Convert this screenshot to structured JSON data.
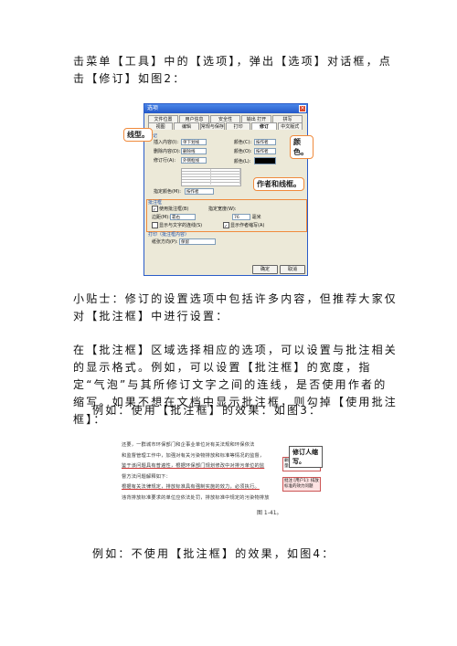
{
  "paragraphs": {
    "p1": "击菜单【工具】中的【选项】，弹出【选项】对话框，点击【修订】如图2：",
    "p2": "小贴士：修订的设置选项中包括许多内容，但推荐大家仅对【批注框】中进行设置：",
    "p3": "在【批注框】区域选择相应的选项，可以设置与批注相关的显示格式。例如，可以设置【批注框】的宽度，指定“气泡”与其所修订文字之间的连线，是否使用作者的缩写。如果不想在文档中显示批注框，则勾掉【使用批注框】：",
    "p4": "例如：使用【批注框】的效果：如图3：",
    "p5": "例如：不使用【批注框】的效果，如图4："
  },
  "fig2": {
    "title": "选项",
    "tabs_row1": [
      "文件位置",
      "用户信息",
      "安全性",
      "输出 打开",
      "拼写"
    ],
    "tabs_row2": [
      "视图",
      "编辑",
      "常规与保存",
      "打印",
      "修订",
      "中文版式"
    ],
    "section_mark": "标记",
    "rows": [
      {
        "label": "插入内容(I):",
        "value": "单下划线",
        "color_label": "颜色(C):",
        "color_value": "按作者"
      },
      {
        "label": "删除内容(D):",
        "value": "删除线",
        "color_label": "颜色(O):",
        "color_value": "按作者"
      },
      {
        "label": "修订行(A):",
        "value": "外侧框线",
        "color_label": "颜色(L):",
        "color_value": ""
      }
    ],
    "format_label": "指定颜色(M):",
    "format_value": "按作者",
    "section_balloon": "批注框",
    "use_balloon": "使用批注框(B)",
    "width_label": "指定宽度(W):",
    "margin_label": "边距(M):",
    "margin_value": "靠右",
    "width_value": "76",
    "width_unit": "毫米",
    "show_lines": "显示与文字的连线(S)",
    "show_author": "显示作者缩写(A)",
    "section_print": "打印（批注框内容）",
    "orientation_label": "纸张方向(P):",
    "orientation_value": "保留",
    "ok": "确定",
    "cancel": "取消",
    "callout_line": "线型。",
    "callout_color": "颜色。",
    "callout_author": "作者和线框。"
  },
  "fig3": {
    "lines": [
      "还要，一群城市环保部门和企事业单位对有关法规和环保依法",
      "和监督管理工作中，加强对有关污染物排放和标准等情况的监督，",
      "鉴于该问题具有普遍性，根据环保部门规划修改中对排污单位的监",
      "督方法问题解释如下：",
      "根据有关法律规定，排放标准具有强制实施的效力，必须执行。",
      "违背排放标准要求的单位应依法处罚，排放标准中规定的污染物排放"
    ],
    "balloon1": "删除的内容(1): 批量的 机关",
    "balloon2": "批注 [用户1]: 排放标准的效力问题",
    "caption": "图 1-41。",
    "callout": "修订人缩写。"
  },
  "colors": {
    "accent": "#f08a3c",
    "titlebar": "#2459c9"
  }
}
